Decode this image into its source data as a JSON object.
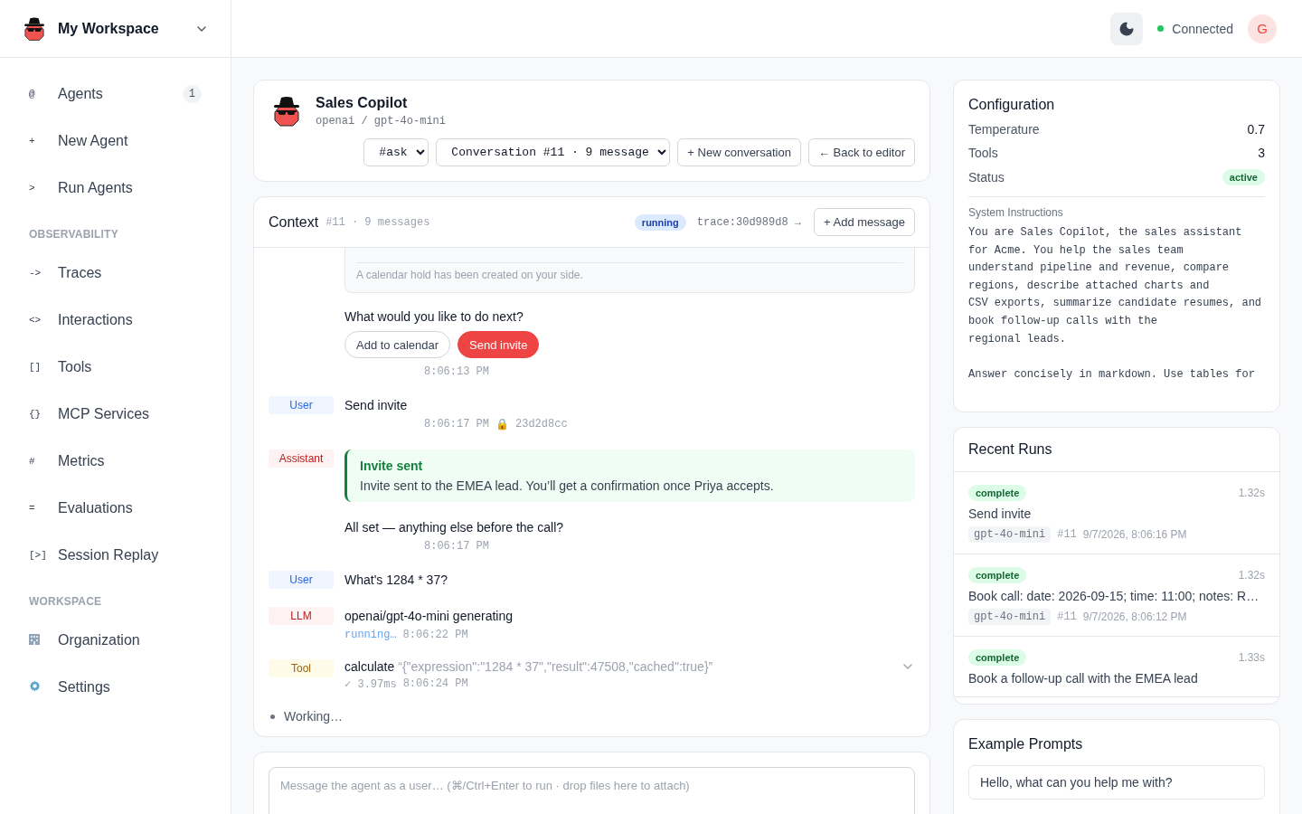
{
  "workspace": {
    "name": "My Workspace"
  },
  "sidebar": {
    "sections": [
      {
        "items": [
          {
            "kind": "glyph",
            "glyph": "@",
            "label": "Agents",
            "count": "1",
            "selected": false
          },
          {
            "kind": "glyph",
            "glyph": "+",
            "label": "New Agent",
            "selected": false
          },
          {
            "kind": "glyph",
            "glyph": ">",
            "label": "Run Agents",
            "selected": false
          }
        ]
      },
      {
        "title": "OBSERVABILITY",
        "items": [
          {
            "kind": "glyph",
            "glyph": "->",
            "label": "Traces",
            "selected": false
          },
          {
            "kind": "glyph",
            "glyph": "<>",
            "label": "Interactions",
            "selected": false
          },
          {
            "kind": "glyph",
            "glyph": "[]",
            "label": "Tools",
            "selected": false
          },
          {
            "kind": "glyph",
            "glyph": "{}",
            "label": "MCP Services",
            "selected": false
          },
          {
            "kind": "glyph",
            "glyph": "#",
            "label": "Metrics",
            "selected": false
          },
          {
            "kind": "glyph",
            "glyph": "=",
            "label": "Evaluations",
            "selected": false
          },
          {
            "kind": "glyph",
            "glyph": "[>]",
            "label": "Session Replay",
            "selected": false
          }
        ]
      },
      {
        "title": "WORKSPACE",
        "items": [
          {
            "kind": "building",
            "label": "Organization",
            "selected": false
          },
          {
            "kind": "gear",
            "label": "Settings",
            "selected": false
          }
        ]
      }
    ]
  },
  "topbar": {
    "connection": "Connected",
    "connected": true,
    "avatar": "G"
  },
  "agent": {
    "name": "Sales Copilot",
    "model": "openai / gpt-4o-mini",
    "mode": "#ask",
    "conversation": "Conversation #11 · 9 message",
    "buttons": [
      "+ New conversation",
      "← Back to editor"
    ]
  },
  "context": {
    "title": "Context",
    "meta": "#11 · 9 messages",
    "status": "running",
    "trace": "trace:30d989d8 →",
    "add_button": "+ Add message",
    "messages": [
      {
        "kind": "continuation",
        "note": "A calendar hold has been created on your side.",
        "text": "What would you like to do next?",
        "actions": [
          {
            "label": "Add to calendar",
            "primary": false
          },
          {
            "label": "Send invite",
            "primary": true
          }
        ],
        "time": "8:06:13 PM"
      },
      {
        "kind": "user",
        "role": "User",
        "text": "Send invite",
        "time": "8:06:17 PM",
        "lock": "🔒",
        "hash": "23d2d8cc"
      },
      {
        "kind": "assistant",
        "role": "Assistant",
        "callout_title": "Invite sent",
        "callout_body": "Invite sent to the EMEA lead. You’ll get a confirmation once Priya accepts.",
        "text": "All set — anything else before the call?",
        "time": "8:06:17 PM"
      },
      {
        "kind": "user",
        "role": "User",
        "text": "What's 1284 * 37?"
      },
      {
        "kind": "llm",
        "role": "LLM",
        "text": "openai/gpt-4o-mini generating",
        "status": "running…",
        "time": "8:06:22 PM"
      },
      {
        "kind": "tool",
        "role": "Tool",
        "text": "calculate",
        "args": "“{\"expression\":\"1284 * 37\",\"result\":47508,\"cached\":true}”",
        "status": "✓ 3.97ms",
        "time": "8:06:24 PM",
        "expanded": false
      }
    ],
    "working": "Working…"
  },
  "composer": {
    "placeholder": "Message the agent as a user… (⌘/Ctrl+Enter to run · drop files here to attach)"
  },
  "configuration": {
    "title": "Configuration",
    "rows": [
      {
        "kind": "value",
        "label": "Temperature",
        "value": "0.7"
      },
      {
        "kind": "value",
        "label": "Tools",
        "value": "3"
      },
      {
        "kind": "badge",
        "label": "Status",
        "value": "active"
      }
    ],
    "instructions_label": "System Instructions",
    "instructions": "You are Sales Copilot, the sales assistant\nfor Acme. You help the sales team\nunderstand pipeline and revenue, compare\nregions, describe attached charts and\nCSV exports, summarize candidate resumes, and\nbook follow-up calls with the\nregional leads.\n\nAnswer concisely in markdown. Use tables for"
  },
  "recent_runs": {
    "title": "Recent Runs",
    "runs": [
      {
        "status": "complete",
        "duration": "1.32s",
        "title": "Send invite",
        "model": "gpt-4o-mini",
        "conversation": "#11",
        "date": "9/7/2026, 8:06:16 PM"
      },
      {
        "status": "complete",
        "duration": "1.32s",
        "title": "Book call: date: 2026-09-15; time: 11:00; notes: R…",
        "model": "gpt-4o-mini",
        "conversation": "#11",
        "date": "9/7/2026, 8:06:12 PM"
      },
      {
        "status": "complete",
        "duration": "1.33s",
        "title": "Book a follow-up call with the EMEA lead"
      }
    ]
  },
  "example_prompts": {
    "title": "Example Prompts",
    "prompts": [
      "Hello, what can you help me with?"
    ]
  }
}
